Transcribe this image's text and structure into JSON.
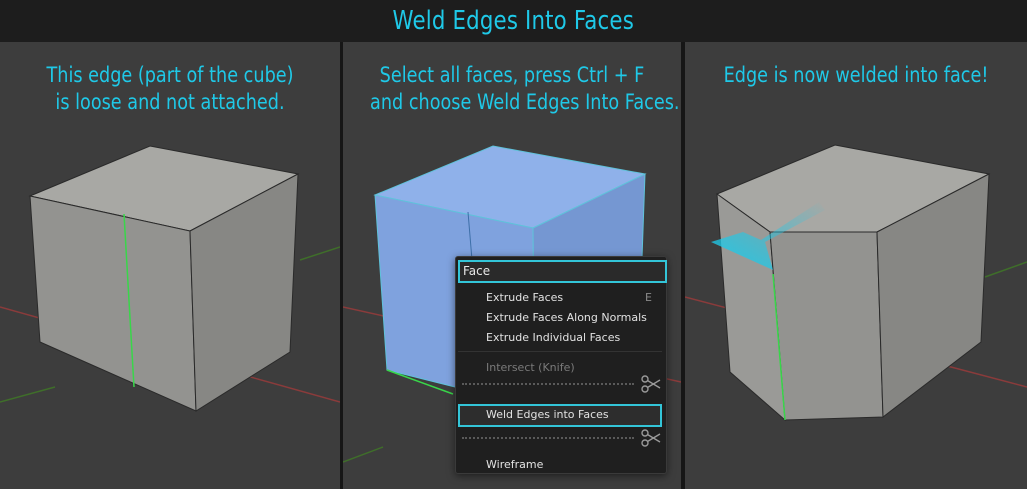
{
  "title": "Weld Edges Into Faces",
  "panels": [
    {
      "caption_line1": "This edge (part of the cube)",
      "caption_line2": "is loose and not attached."
    },
    {
      "caption_line1": "Select all faces, press Ctrl + F",
      "caption_line2": "and choose Weld Edges Into Faces."
    },
    {
      "caption_line1": "Edge is now welded into face!",
      "caption_line2": ""
    }
  ],
  "menu": {
    "search_value": "Face",
    "items": [
      {
        "label": "Extrude Faces",
        "shortcut": "E",
        "enabled": true
      },
      {
        "label": "Extrude Faces Along Normals",
        "shortcut": "",
        "enabled": true
      },
      {
        "label": "Extrude Individual Faces",
        "shortcut": "",
        "enabled": true
      },
      {
        "label": "Intersect (Knife)",
        "shortcut": "",
        "enabled": false
      },
      {
        "label": "Weld Edges into Faces",
        "shortcut": "",
        "enabled": true,
        "highlighted": true
      },
      {
        "label": "Wireframe",
        "shortcut": "",
        "enabled": true
      }
    ]
  },
  "colors": {
    "accent": "#1fc9e8",
    "viewport": "#3d3d3d",
    "x_axis": "#8a3b3b",
    "y_axis": "#3f6e2a",
    "loose_edge": "#39d64a",
    "selected_face": "#8aaee8"
  }
}
